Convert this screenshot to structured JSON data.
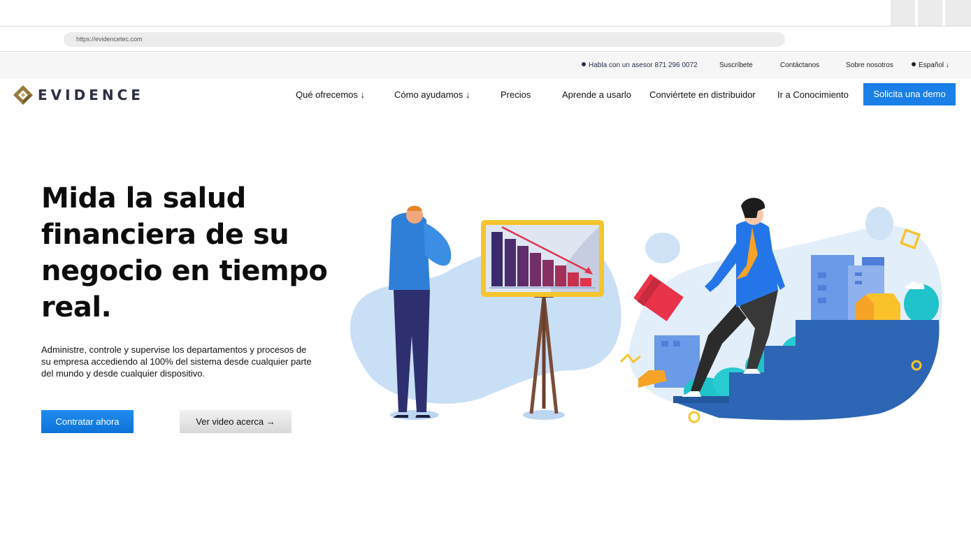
{
  "browser": {
    "url": "https://evidencetec.com"
  },
  "utility_bar": {
    "advisor": "Habla con un asesor",
    "phone": "871 296 0072",
    "subscribe": "Suscríbete",
    "contact": "Contáctanos",
    "about": "Sobre nosotros",
    "language": "Español ↓"
  },
  "nav": {
    "logo_text": "EVIDENCE",
    "items": [
      {
        "label": "Qué ofrecemos ↓"
      },
      {
        "label": "Cómo ayudamos ↓"
      },
      {
        "label": "Precios"
      },
      {
        "label": "Aprende a usarlo"
      },
      {
        "label": "Conviértete en distribuidor"
      },
      {
        "label": "Ir a Conocimiento"
      }
    ],
    "demo_button": "Solicita una demo"
  },
  "hero": {
    "title": "Mida la salud financiera de su negocio en tiempo real.",
    "description": "Administre, controle y supervise los departamentos y procesos de su empresa accediendo al 100% del sistema desde cualquier parte del mundo y desde cualquier dispositivo.",
    "primary_button": "Contratar ahora",
    "secondary_button": "Ver video acerca →"
  },
  "colors": {
    "accent": "#1a7fe6",
    "logo_gold": "#9a7a3c",
    "logo_text": "#2b2f45"
  },
  "icons": [
    "logo-mark-icon",
    "globe-dot-icon"
  ]
}
